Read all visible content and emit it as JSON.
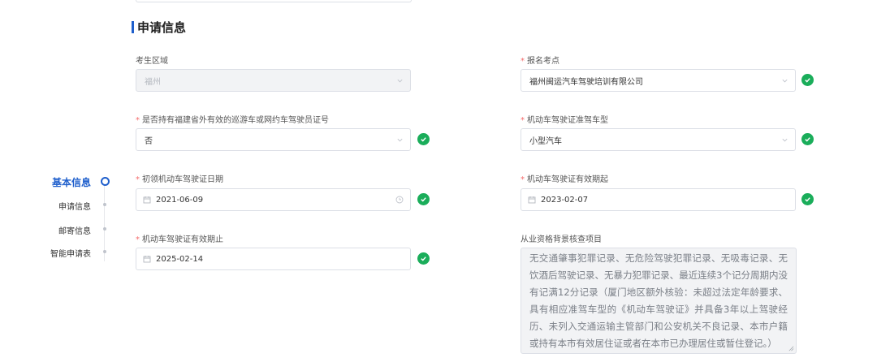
{
  "section": {
    "title": "申请信息"
  },
  "fields": {
    "region": {
      "label": "考生区域",
      "value": "福州"
    },
    "exam_site": {
      "label": "报名考点",
      "value": "福州闽运汽车驾驶培训有限公司"
    },
    "has_license": {
      "label": "是否持有福建省外有效的巡游车或网约车驾驶员证号",
      "value": "否"
    },
    "vehicle_type": {
      "label": "机动车驾驶证准驾车型",
      "value": "小型汽车"
    },
    "first_license_date": {
      "label": "初领机动车驾驶证日期",
      "value": "2021-06-09"
    },
    "valid_from": {
      "label": "机动车驾驶证有效期起",
      "value": "2023-02-07"
    },
    "valid_to": {
      "label": "机动车驾驶证有效期止",
      "value": "2025-02-14"
    },
    "background_check": {
      "label": "从业资格背景核查项目",
      "value": "无交通肇事犯罪记录、无危险驾驶犯罪记录、无吸毒记录、无饮酒后驾驶记录、无暴力犯罪记录、最近连续3个记分周期内没有记满12分记录（厦门地区额外核验：未超过法定年龄要求、具有相应准驾车型的《机动车驾驶证》并具备3年以上驾驶经历、未列入交通运输主管部门和公安机关不良记录、本市户籍或持有本市有效居住证或者在本市已办理居住或暂住登记。）"
    }
  },
  "nav": {
    "items": [
      {
        "label": "基本信息",
        "active": true
      },
      {
        "label": "申请信息",
        "active": false
      },
      {
        "label": "邮寄信息",
        "active": false
      },
      {
        "label": "智能申请表",
        "active": false
      }
    ]
  },
  "icons": {
    "select": "chevron-down-icon",
    "date": "calendar-icon",
    "clear": "clock-icon",
    "valid": "check-circle-icon"
  },
  "colors": {
    "accent": "#1f5fcc",
    "success": "#1aad5a",
    "required": "#f56c6c"
  }
}
